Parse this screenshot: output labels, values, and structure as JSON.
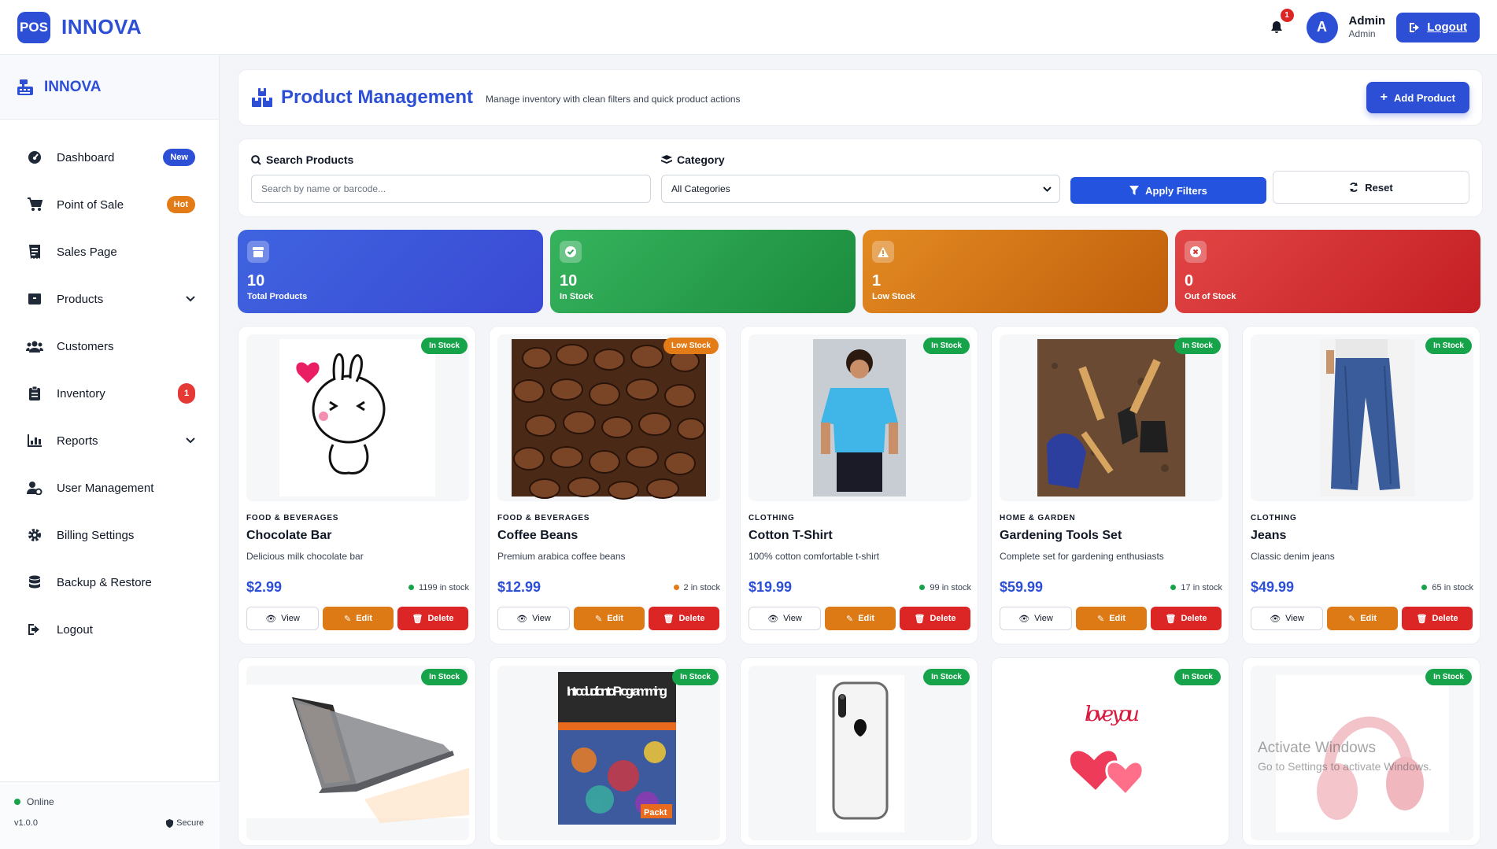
{
  "header": {
    "logo_text": "POS",
    "brand": "INNOVA",
    "notification_count": "1",
    "avatar_initial": "A",
    "user_name": "Admin",
    "user_role": "Admin",
    "logout_label": "Logout"
  },
  "sidebar": {
    "brand": "INNOVA",
    "items": [
      {
        "label": "Dashboard",
        "icon": "gauge-icon",
        "badge": "New",
        "badge_type": "new"
      },
      {
        "label": "Point of Sale",
        "icon": "cart-icon",
        "badge": "Hot",
        "badge_type": "hot"
      },
      {
        "label": "Sales Page",
        "icon": "receipt-icon"
      },
      {
        "label": "Products",
        "icon": "box-icon",
        "chevron": true
      },
      {
        "label": "Customers",
        "icon": "users-icon"
      },
      {
        "label": "Inventory",
        "icon": "clipboard-icon",
        "badge": "1",
        "badge_type": "num"
      },
      {
        "label": "Reports",
        "icon": "chart-icon",
        "chevron": true
      },
      {
        "label": "User Management",
        "icon": "user-gear-icon"
      },
      {
        "label": "Billing Settings",
        "icon": "gear-icon"
      },
      {
        "label": "Backup & Restore",
        "icon": "database-icon"
      },
      {
        "label": "Logout",
        "icon": "logout-icon"
      }
    ],
    "footer": {
      "status": "Online",
      "version": "v1.0.0",
      "secure": "Secure"
    }
  },
  "page": {
    "title": "Product Management",
    "subtitle": "Manage inventory with clean filters and quick product actions",
    "add_button": "Add Product"
  },
  "filters": {
    "search_label": "Search Products",
    "search_placeholder": "Search by name or barcode...",
    "category_label": "Category",
    "category_selected": "All Categories",
    "apply_label": "Apply Filters",
    "reset_label": "Reset"
  },
  "stats": [
    {
      "value": "10",
      "label": "Total Products",
      "color": "#3a56da"
    },
    {
      "value": "10",
      "label": "In Stock",
      "color": "#27a34c"
    },
    {
      "value": "1",
      "label": "Low Stock",
      "color": "#d8761a"
    },
    {
      "value": "0",
      "label": "Out of Stock",
      "color": "#d33030"
    }
  ],
  "products": [
    {
      "status": "In Stock",
      "category": "FOOD & BEVERAGES",
      "name": "Chocolate Bar",
      "description": "Delicious milk chocolate bar",
      "price": "$2.99",
      "stock": "1199 in stock",
      "stock_color": "#16a34a"
    },
    {
      "status": "Low Stock",
      "category": "FOOD & BEVERAGES",
      "name": "Coffee Beans",
      "description": "Premium arabica coffee beans",
      "price": "$12.99",
      "stock": "2 in stock",
      "stock_color": "#e37b16"
    },
    {
      "status": "In Stock",
      "category": "CLOTHING",
      "name": "Cotton T-Shirt",
      "description": "100% cotton comfortable t-shirt",
      "price": "$19.99",
      "stock": "99 in stock",
      "stock_color": "#16a34a"
    },
    {
      "status": "In Stock",
      "category": "HOME & GARDEN",
      "name": "Gardening Tools Set",
      "description": "Complete set for gardening enthusiasts",
      "price": "$59.99",
      "stock": "17 in stock",
      "stock_color": "#16a34a"
    },
    {
      "status": "In Stock",
      "category": "CLOTHING",
      "name": "Jeans",
      "description": "Classic denim jeans",
      "price": "$49.99",
      "stock": "65 in stock",
      "stock_color": "#16a34a"
    },
    {
      "status": "In Stock"
    },
    {
      "status": "In Stock",
      "book_title": "Introduction to Programming",
      "book_publisher": "Packt"
    },
    {
      "status": "In Stock"
    },
    {
      "status": "In Stock",
      "art_text": "love you"
    },
    {
      "status": "In Stock"
    }
  ],
  "product_actions": {
    "view": "View",
    "edit": "Edit",
    "delete": "Delete"
  },
  "watermark": {
    "line1": "Activate Windows",
    "line2": "Go to Settings to activate Windows."
  }
}
